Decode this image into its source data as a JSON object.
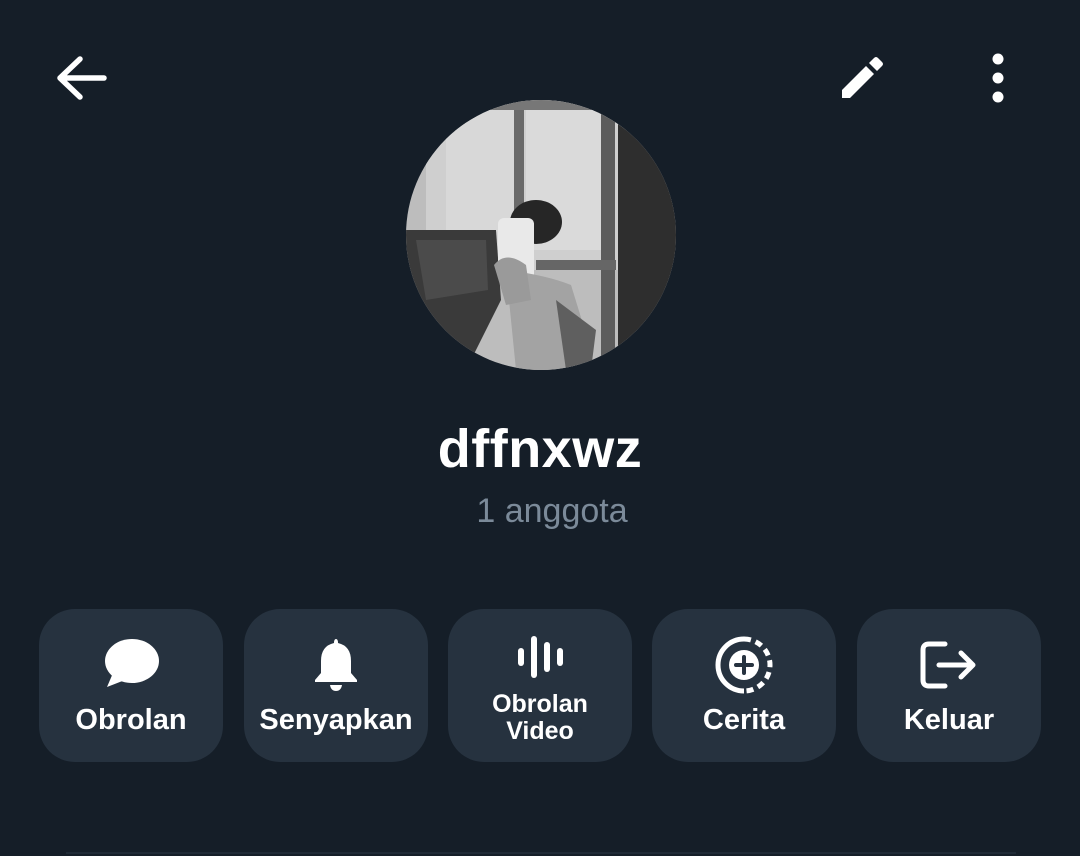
{
  "header": {
    "back_icon": "arrow-left-icon",
    "edit_icon": "pencil-icon",
    "more_icon": "more-vertical-icon"
  },
  "profile": {
    "avatar_description": "black-and-white mirror selfie photo",
    "name": "dffnxwz",
    "subtitle": "1 anggota"
  },
  "actions": [
    {
      "label": "Obrolan",
      "icon": "chat-bubble-icon"
    },
    {
      "label": "Senyapkan",
      "icon": "bell-icon"
    },
    {
      "label": "Obrolan Video",
      "icon": "voice-chat-icon"
    },
    {
      "label": "Cerita",
      "icon": "story-add-icon"
    },
    {
      "label": "Keluar",
      "icon": "logout-icon"
    }
  ],
  "colors": {
    "background": "#151e28",
    "button_background": "#26323f",
    "subtitle": "#7b8a99",
    "text": "#ffffff"
  }
}
